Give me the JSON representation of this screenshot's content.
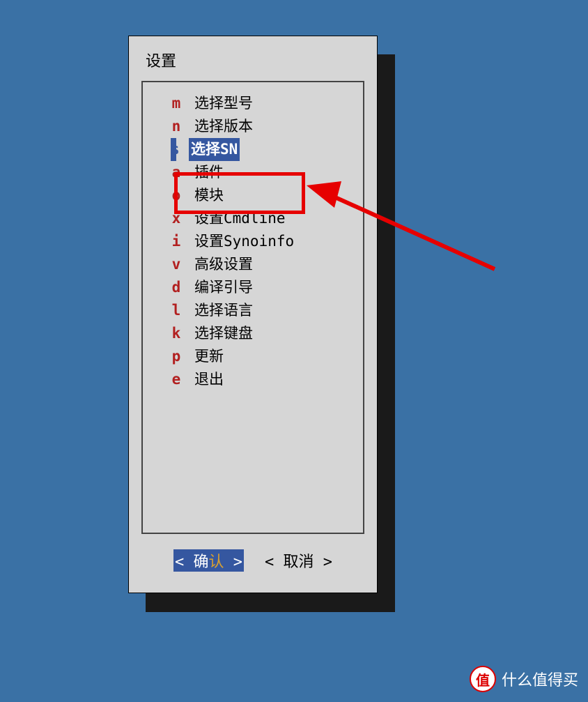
{
  "dialog": {
    "title": "设置",
    "menu": [
      {
        "key": "m",
        "label": "选择型号",
        "selected": false
      },
      {
        "key": "n",
        "label": "选择版本",
        "selected": false
      },
      {
        "key": "s",
        "label": "选择SN",
        "selected": true
      },
      {
        "key": "a",
        "label": "插件",
        "selected": false,
        "highlighted": true
      },
      {
        "key": "o",
        "label": "模块",
        "selected": false
      },
      {
        "key": "x",
        "label": "设置Cmdline",
        "selected": false
      },
      {
        "key": "i",
        "label": "设置Synoinfo",
        "selected": false
      },
      {
        "key": "v",
        "label": "高级设置",
        "selected": false
      },
      {
        "key": "d",
        "label": "编译引导",
        "selected": false
      },
      {
        "key": "l",
        "label": "选择语言",
        "selected": false
      },
      {
        "key": "k",
        "label": "选择键盘",
        "selected": false
      },
      {
        "key": "p",
        "label": "更新",
        "selected": false
      },
      {
        "key": "e",
        "label": "退出",
        "selected": false
      }
    ],
    "buttons": {
      "ok": {
        "pre": "确",
        "hotkey": "认",
        "selected": true
      },
      "cancel": {
        "label": "取消",
        "selected": false
      }
    }
  },
  "watermark": {
    "badge": "值",
    "text": "什么值得买"
  }
}
